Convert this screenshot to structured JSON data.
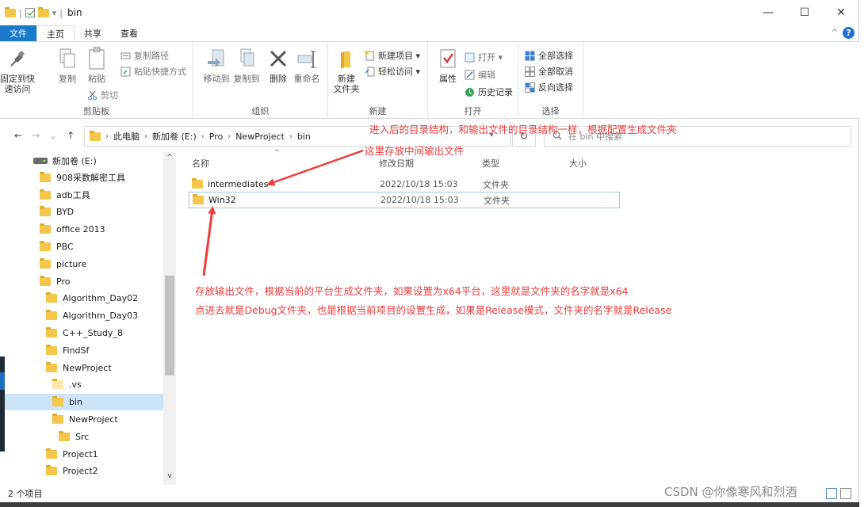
{
  "titlebar": {
    "title": "bin",
    "separator": "|",
    "dropdown": "▾",
    "minimize": "—",
    "maximize": "☐",
    "close": "✕"
  },
  "tabs": [
    {
      "label": "文件"
    },
    {
      "label": "主页"
    },
    {
      "label": "共享"
    },
    {
      "label": "查看"
    }
  ],
  "ribbon": {
    "collapse": "^",
    "help": "?",
    "clipboard": {
      "pin": "固定到快\n速访问",
      "copy": "复制",
      "paste": "粘贴",
      "copy_path": "复制路径",
      "paste_shortcut": "粘贴快捷方式",
      "cut": "剪切",
      "label": "剪贴板"
    },
    "organize": {
      "move_to": "移动到",
      "copy_to": "复制到",
      "delete": "删除",
      "rename": "重命名",
      "label": "组织"
    },
    "new": {
      "new_folder": "新建\n文件夹",
      "new_item": "新建项目 ▾",
      "easy_access": "轻松访问 ▾",
      "label": "新建"
    },
    "open": {
      "properties": "属性",
      "open": "打开 ▾",
      "edit": "编辑",
      "history": "历史记录",
      "label": "打开"
    },
    "select": {
      "select_all": "全部选择",
      "select_none": "全部取消",
      "invert": "反向选择",
      "label": "选择"
    }
  },
  "navbar": {
    "back": "←",
    "forward": "→",
    "recent": "⌄",
    "up": "↑",
    "crumbs": [
      "此电脑",
      "新加卷 (E:)",
      "Pro",
      "NewProject",
      "bin"
    ],
    "crumb_sep": "›",
    "refresh": "↻",
    "search_placeholder": "在 bin 中搜索"
  },
  "tree": [
    {
      "label": "新加卷 (E:)",
      "kind": "drive"
    },
    {
      "label": "908采数解密工具",
      "kind": "folder"
    },
    {
      "label": "adb工具",
      "kind": "folder"
    },
    {
      "label": "BYD",
      "kind": "folder"
    },
    {
      "label": "office 2013",
      "kind": "folder"
    },
    {
      "label": "PBC",
      "kind": "folder"
    },
    {
      "label": "picture",
      "kind": "folder"
    },
    {
      "label": "Pro",
      "kind": "folder"
    },
    {
      "label": "Algorithm_Day02",
      "kind": "folder"
    },
    {
      "label": "Algorithm_Day03",
      "kind": "folder"
    },
    {
      "label": "C++_Study_8",
      "kind": "folder"
    },
    {
      "label": "FindSf",
      "kind": "folder"
    },
    {
      "label": "NewProject",
      "kind": "folder"
    },
    {
      "label": ".vs",
      "kind": "folder-light"
    },
    {
      "label": "bin",
      "kind": "folder",
      "selected": true
    },
    {
      "label": "NewProject",
      "kind": "folder"
    },
    {
      "label": "Src",
      "kind": "folder"
    },
    {
      "label": "Project1",
      "kind": "folder"
    },
    {
      "label": "Project2",
      "kind": "folder"
    }
  ],
  "columns": {
    "name": "名称",
    "date": "修改日期",
    "type": "类型",
    "size": "大小",
    "sort_caret": "^"
  },
  "files": [
    {
      "name": "intermediates",
      "date": "2022/10/18 15:03",
      "type": "文件夹"
    },
    {
      "name": "Win32",
      "date": "2022/10/18 15:03",
      "type": "文件夹",
      "selected": true
    }
  ],
  "annotations": {
    "top": "进入后的目录结构，和输出文件的目录结构一样，根据配置生成文件夹",
    "intermediates": "这里存放中间输出文件",
    "line1": "存放输出文件，根据当前的平台生成文件夹，如果设置为x64平台，这里就是文件夹的名字就是x64",
    "line2": "点进去就是Debug文件夹，也是根据当前项目的设置生成，如果是Release模式，文件夹的名字就是Release"
  },
  "status": {
    "count": "2 个项目"
  },
  "watermark": "CSDN @你像寒风和烈酒",
  "colors": {
    "accent": "#1979ca",
    "annotation": "#ef3b3b",
    "folder": "#f4c64a",
    "selection": "#cde4f7"
  }
}
